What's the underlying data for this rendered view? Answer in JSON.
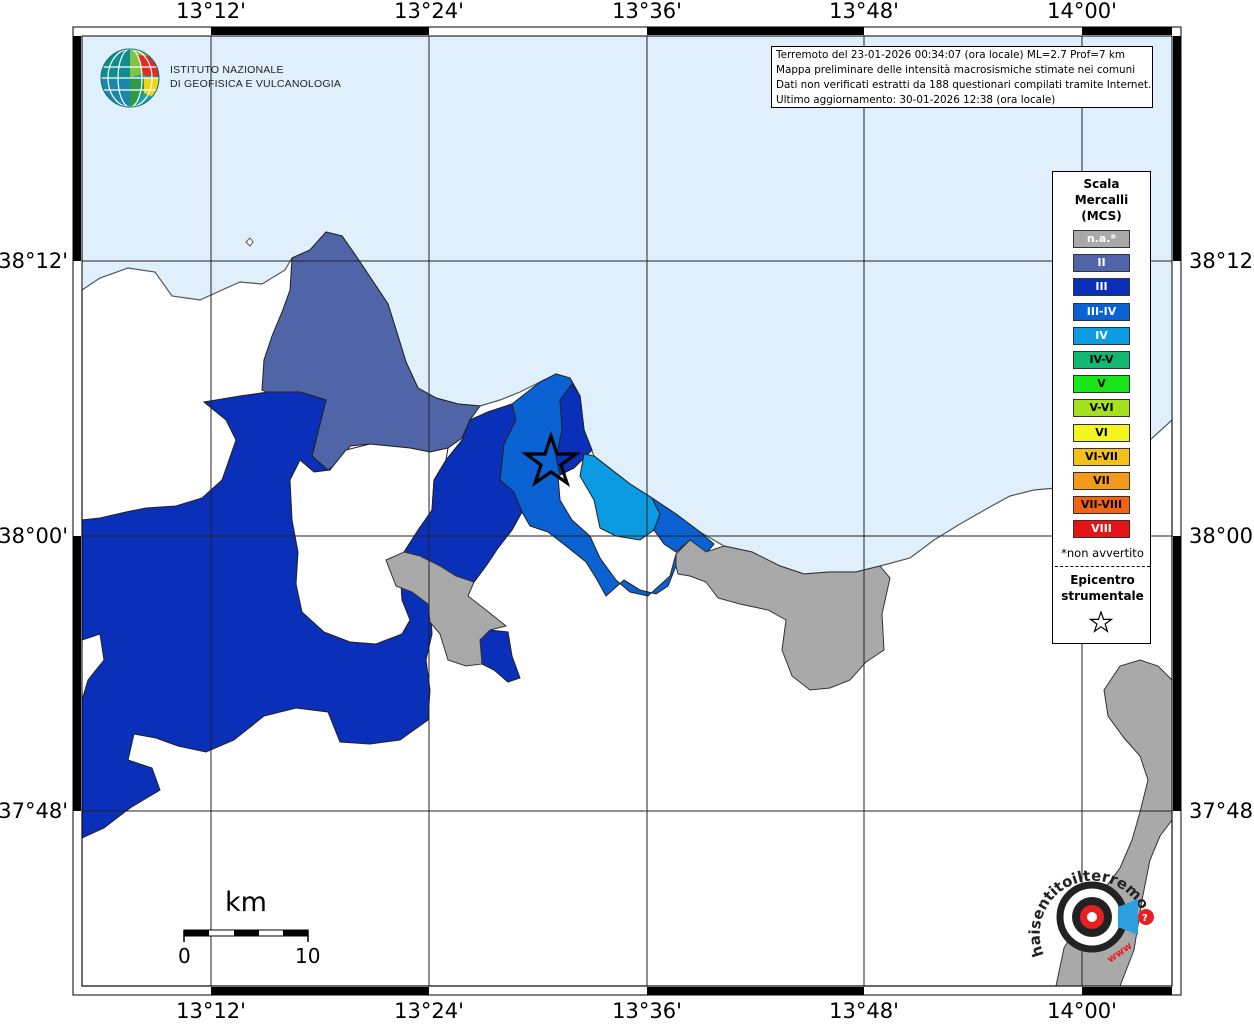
{
  "map": {
    "lon_labels": [
      "13°12'",
      "13°24'",
      "13°36'",
      "13°48'",
      "14°00'"
    ],
    "lat_labels": [
      "38°12'",
      "38°00'",
      "37°48'"
    ]
  },
  "info": {
    "line1": "Terremoto del 23-01-2026 00:34:07 (ora locale) ML=2.7 Prof=7 km",
    "line2": "Mappa preliminare delle intensità macrosismiche stimate nei comuni",
    "line3": "Dati non verificati estratti da 188 questionari compilati tramite Internet.",
    "line4": "Ultimo aggiornamento: 30-01-2026 12:38 (ora locale)"
  },
  "legend": {
    "title_lines": [
      "Scala",
      "Mercalli",
      "(MCS)"
    ],
    "items": [
      {
        "label": "n.a.*",
        "color": "#a9a9a9",
        "text_color": "#ffffff"
      },
      {
        "label": "II",
        "color": "#5064a8",
        "text_color": "#ffffff"
      },
      {
        "label": "III",
        "color": "#0a2fb8",
        "text_color": "#ffffff"
      },
      {
        "label": "III-IV",
        "color": "#0a62d2",
        "text_color": "#ffffff"
      },
      {
        "label": "IV",
        "color": "#0b9be3",
        "text_color": "#ffffff"
      },
      {
        "label": "IV-V",
        "color": "#12b870",
        "text_color": "#000000"
      },
      {
        "label": "V",
        "color": "#19e619",
        "text_color": "#000000"
      },
      {
        "label": "V-VI",
        "color": "#a6e11e",
        "text_color": "#000000"
      },
      {
        "label": "VI",
        "color": "#f5f51e",
        "text_color": "#000000"
      },
      {
        "label": "VI-VII",
        "color": "#f4c01a",
        "text_color": "#000000"
      },
      {
        "label": "VII",
        "color": "#f49a1a",
        "text_color": "#000000"
      },
      {
        "label": "VII-VIII",
        "color": "#f26414",
        "text_color": "#000000"
      },
      {
        "label": "VIII",
        "color": "#e61414",
        "text_color": "#ffffff"
      }
    ],
    "not_felt_note": "*non avvertito",
    "epicenter_line1": "Epicentro",
    "epicenter_line2": "strumentale"
  },
  "ingv": {
    "line1": "ISTITUTO NAZIONALE",
    "line2": "DI GEOFISICA E VULCANOLOGIA"
  },
  "scalebar": {
    "unit": "km",
    "min": "0",
    "max": "10"
  },
  "hsst": {
    "text": "haisentitoilterremoto.it",
    "url": "www"
  }
}
